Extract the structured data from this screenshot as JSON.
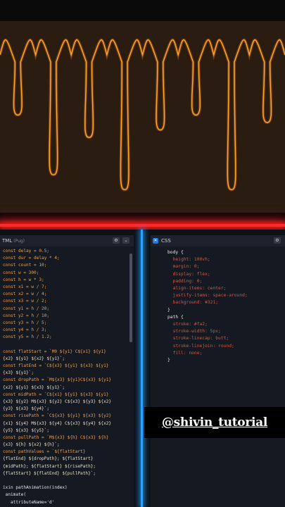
{
  "html_pane": {
    "title": "TML",
    "subtitle": "(Pug)",
    "lines": [
      "const delay = 0.5;",
      "const dur = delay * 4;",
      "const count = 10;",
      "const w = 300;",
      "const h = w * 3;",
      "const x1 = w / 7;",
      "const x2 = w / 4;",
      "const x3 = w / 2;",
      "const y1 = h / 20;",
      "const y2 = h / 10;",
      "const y3 = h / 5;",
      "const y4 = h / 3;",
      "const y5 = h / 1.2;",
      "",
      "const flatStart = `M0 ${y1} C${x1} ${y1}",
      "{x2} ${y1} ${x2} ${y1}`;",
      "const flatEnd = `C${x3} ${y1} ${x3} ${y1}",
      "{x3} ${y1}`;",
      "const dropPath = `M${x3} ${y1}C${x3} ${y1}",
      "{x2} ${y1} ${x3} ${y1}`;",
      "const midPath = `C${x1} ${y1} ${x3} ${y1}",
      "{x3} ${y2} M${x3} ${y2} C${x3} ${y3} ${x2}",
      "{y3} ${x3} ${y4}`;",
      "const risePath = `C${x3} ${y1} ${x3} ${y2}",
      "{x1} ${y4} M${x3} ${y4} C${x3} ${y4} ${x2}",
      "{y5} ${x3} ${y5}`;",
      "const pullPath = `M${x3} ${h} C${x3} ${h}",
      "{x3} ${h} ${x2} ${h}`;",
      "const pathValues = `${flatStart}",
      "{flatEnd} ${dropPath}; ${flatStart}",
      "{midPath}; ${flatStart} ${risePath};",
      "{flatStart} ${flatEnd} ${pullPath}`;",
      "",
      "ixin pathAnimation(index)",
      " animate(",
      "   attributeName='d'"
    ]
  },
  "css_pane": {
    "title": "CSS",
    "lines": [
      "body {",
      "  height: 100vh;",
      "  margin: 0;",
      "  display: flex;",
      "  padding: 0;",
      "  align-items: center;",
      "  justify-items: space-around;",
      "  background: #321;",
      "}",
      "",
      "path {",
      "  stroke: #fa2;",
      "  stroke-width: 5px;",
      "  stroke-linecap: butt;",
      "  stroke-linejoin: round;",
      "  fill: none;",
      "}"
    ]
  },
  "controls": {
    "settings": "⚙",
    "collapse": "⌄"
  },
  "watermark": "@shivin_tutorial",
  "preview": {
    "background": "#2a1c10",
    "stroke": "#ffaa22",
    "drip_depths": [
      0.45,
      0.85,
      0.6,
      0.95,
      0.55,
      0.45,
      0.95,
      0.5
    ]
  }
}
